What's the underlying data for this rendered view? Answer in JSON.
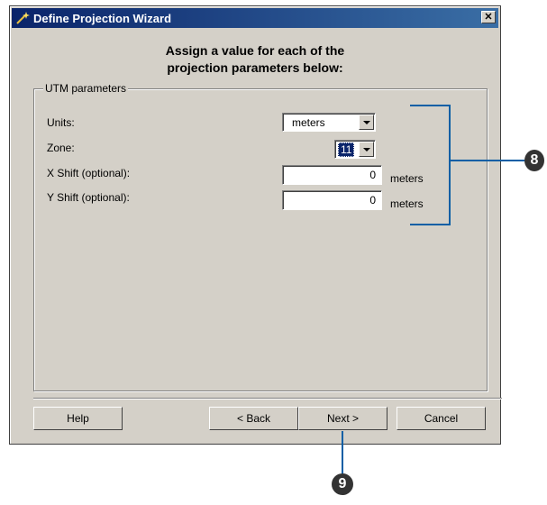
{
  "window": {
    "title": "Define Projection Wizard",
    "close_glyph": "✕"
  },
  "heading": {
    "line1": "Assign a value for each of the",
    "line2": "projection parameters below:"
  },
  "group": {
    "label": "UTM parameters"
  },
  "fields": {
    "units": {
      "label": "Units:",
      "value": "meters"
    },
    "zone": {
      "label": "Zone:",
      "value": "11"
    },
    "x_shift": {
      "label": "X Shift (optional):",
      "value": "0",
      "unit": "meters"
    },
    "y_shift": {
      "label": "Y Shift (optional):",
      "value": "0",
      "unit": "meters"
    }
  },
  "buttons": {
    "help": "Help",
    "back": "< Back",
    "next": "Next >",
    "cancel": "Cancel"
  },
  "callouts": {
    "step8": "8",
    "step9": "9"
  },
  "colors": {
    "callout_line": "#0b5fa5",
    "title_bar": "#0a246a"
  }
}
